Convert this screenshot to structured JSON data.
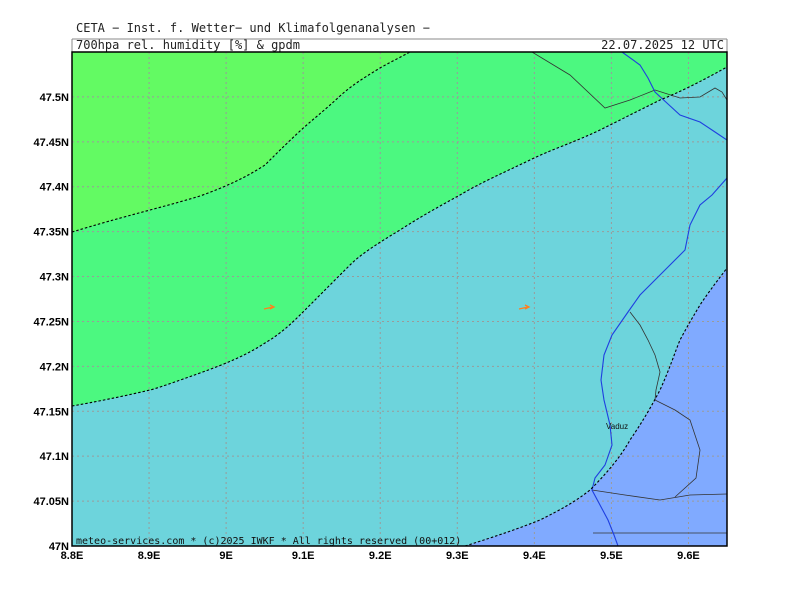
{
  "header": {
    "institute": "CETA − Inst. f. Wetter− und Klimafolgenanalysen −",
    "parameter": "700hpa_rel._humidity_[%]_&_gpdm",
    "datetime": "22.07.2025 12 UTC"
  },
  "footer": {
    "copyright": "meteo-services.com * (c)2025 IWKF * All rights reserved (00+012)"
  },
  "places": {
    "vaduz": "Vaduz"
  },
  "extent": {
    "lon": [
      8.8,
      9.65
    ],
    "lat": [
      47.0,
      47.55
    ]
  },
  "lon_ticks": [
    {
      "value": 8.8,
      "label": "8.8E"
    },
    {
      "value": 8.9,
      "label": "8.9E"
    },
    {
      "value": 9.0,
      "label": "9E"
    },
    {
      "value": 9.1,
      "label": "9.1E"
    },
    {
      "value": 9.2,
      "label": "9.2E"
    },
    {
      "value": 9.3,
      "label": "9.3E"
    },
    {
      "value": 9.4,
      "label": "9.4E"
    },
    {
      "value": 9.5,
      "label": "9.5E"
    },
    {
      "value": 9.6,
      "label": "9.6E"
    }
  ],
  "lat_ticks": [
    {
      "value": 47.0,
      "label": "47N"
    },
    {
      "value": 47.05,
      "label": "47.05N"
    },
    {
      "value": 47.1,
      "label": "47.1N"
    },
    {
      "value": 47.15,
      "label": "47.15N"
    },
    {
      "value": 47.2,
      "label": "47.2N"
    },
    {
      "value": 47.25,
      "label": "47.25N"
    },
    {
      "value": 47.3,
      "label": "47.3N"
    },
    {
      "value": 47.35,
      "label": "47.35N"
    },
    {
      "value": 47.4,
      "label": "47.4N"
    },
    {
      "value": 47.45,
      "label": "47.45N"
    },
    {
      "value": 47.5,
      "label": "47.5N"
    }
  ],
  "colors": {
    "light_green": "#63fa63",
    "green": "#4cf880",
    "cyan": "#6dd4dc",
    "blue": "#80aaff",
    "river": "#1f3fe0",
    "border": "#333333",
    "wind_arrow": "#ff7f1e"
  }
}
